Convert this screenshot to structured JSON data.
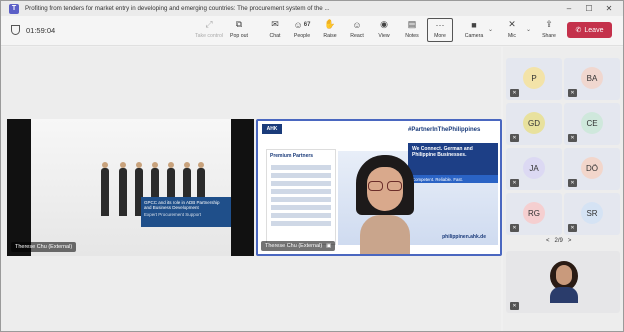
{
  "window": {
    "title": "Profiting from tenders for market entry in developing and emerging countries: The procurement system of the ...",
    "app_icon": "T",
    "controls": [
      "–",
      "☐",
      "✕"
    ]
  },
  "toolbar": {
    "timer": "01:59:04",
    "items": [
      {
        "label": "Take control",
        "icon": "⤢"
      },
      {
        "label": "Pop out",
        "icon": "⧉"
      },
      {
        "label": "Chat",
        "icon": "✉"
      },
      {
        "label": "People",
        "icon": "☺",
        "count": "67"
      },
      {
        "label": "Raise",
        "icon": "✋"
      },
      {
        "label": "React",
        "icon": "☺"
      },
      {
        "label": "View",
        "icon": "◉"
      },
      {
        "label": "Notes",
        "icon": "▤"
      },
      {
        "label": "More",
        "icon": "···"
      },
      {
        "label": "Camera",
        "icon": "■"
      },
      {
        "label": "Mic",
        "icon": "✕"
      },
      {
        "label": "Share",
        "icon": "⇪"
      }
    ],
    "leave": {
      "label": "Leave",
      "icon": "✆"
    }
  },
  "stage": {
    "main_tile": {
      "name": "Therese Chu (External)",
      "slide_heading": "GPCC and its role in ADB Partnership and Business Development",
      "slide_sub": "Expert Procurement Support"
    },
    "second_tile": {
      "name": "Therese Chu (External)",
      "logo": "AHK",
      "brand": "#PartnerInThePhilippines",
      "partners_title": "Premium Partners",
      "connect_text": "We Connect. German and Philippine Businesses.",
      "tagline": "Competent. Reliable. Fast.",
      "url": "philippinen.ahk.de"
    }
  },
  "participants": [
    {
      "initials": "P",
      "color": "#f3e3a8"
    },
    {
      "initials": "BA",
      "color": "#f0d7cf"
    },
    {
      "initials": "GD",
      "color": "#e8e19d"
    },
    {
      "initials": "CE",
      "color": "#cfe8dc"
    },
    {
      "initials": "JA",
      "color": "#dcd9f3"
    },
    {
      "initials": "DÖ",
      "color": "#f2d6cb"
    },
    {
      "initials": "RG",
      "color": "#f5cfd0"
    },
    {
      "initials": "SR",
      "color": "#d5e3f4"
    }
  ],
  "pager": {
    "prev": "<",
    "label": "2/9",
    "next": ">"
  }
}
